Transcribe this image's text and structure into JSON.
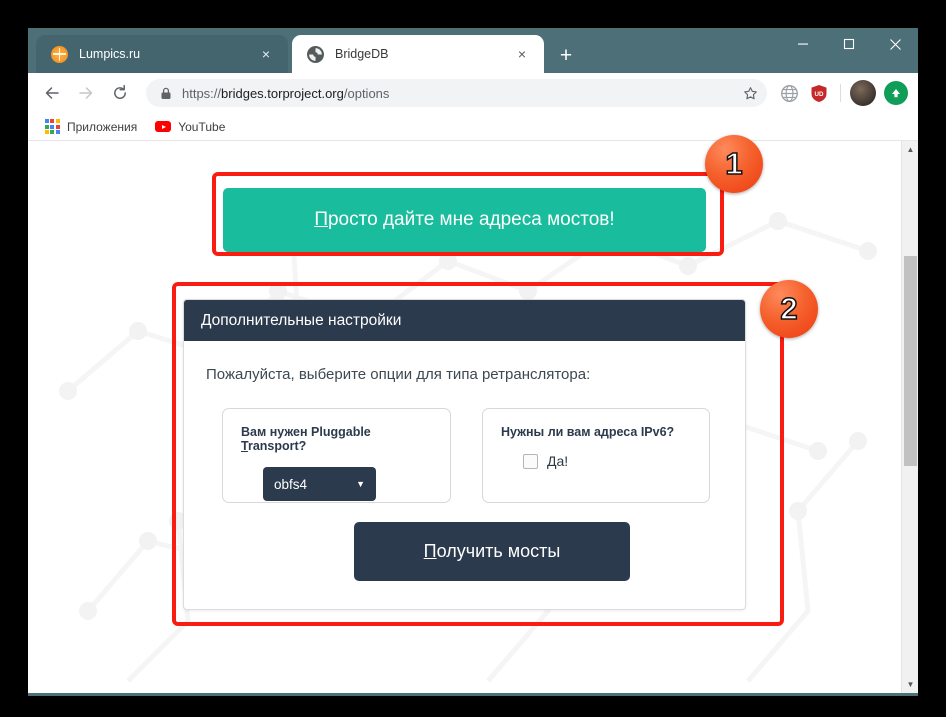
{
  "window": {
    "controls": {
      "minimize": "minimize-button",
      "maximize": "maximize-button",
      "close": "close-button"
    }
  },
  "tabs": [
    {
      "title": "Lumpics.ru",
      "favicon": "orange-slice-icon",
      "active": false,
      "close": "×"
    },
    {
      "title": "BridgeDB",
      "favicon": "tor-onion-icon",
      "active": true,
      "close": "×"
    }
  ],
  "new_tab_label": "+",
  "toolbar": {
    "back_label": "back-icon",
    "forward_label": "forward-icon",
    "reload_label": "reload-icon",
    "lock_label": "lock-icon",
    "url_scheme": "https://",
    "url_host": "bridges.torproject.org",
    "url_path": "/options",
    "star_label": "star-icon",
    "extension_globe": "globe-icon",
    "extension_shield": "UD",
    "avatar_label": "avatar",
    "update_label": "update-arrow-icon"
  },
  "bookmarks": [
    {
      "label": "Приложения",
      "icon": "apps-grid-icon"
    },
    {
      "label": "YouTube",
      "icon": "youtube-icon"
    }
  ],
  "page": {
    "primary_button": {
      "accesskey": "П",
      "rest": "росто дайте мне адреса мостов!",
      "full": "Просто дайте мне адреса мостов!"
    },
    "panel": {
      "header": "Дополнительные настройки",
      "instruction": "Пожалуйста, выберите опции для типа ретранслятора:",
      "transport": {
        "label_before": "Вам нужен Pluggable ",
        "label_accesskey": "T",
        "label_after": "ransport?",
        "selected_option": "obfs4",
        "caret": "▼",
        "options": [
          "obfs4"
        ]
      },
      "ipv6": {
        "label": "Нужны ли вам адреса IPv6?",
        "checkbox_checked": false,
        "checkbox_accesskey": "Д",
        "checkbox_label_rest": "а!"
      },
      "submit": {
        "accesskey": "П",
        "rest": "олучить мосты",
        "full": "Получить мосты"
      }
    }
  },
  "annotations": [
    {
      "number": "1"
    },
    {
      "number": "2"
    }
  ],
  "colors": {
    "tab_bar": "#4d6f78",
    "accent_teal": "#19bc9c",
    "panel_dark": "#2b3a4d",
    "annotation_red": "#f91c11",
    "badge_orange": "#ef3a11"
  },
  "scrollbar": {
    "up_arrow": "▲",
    "down_arrow": "▼"
  }
}
